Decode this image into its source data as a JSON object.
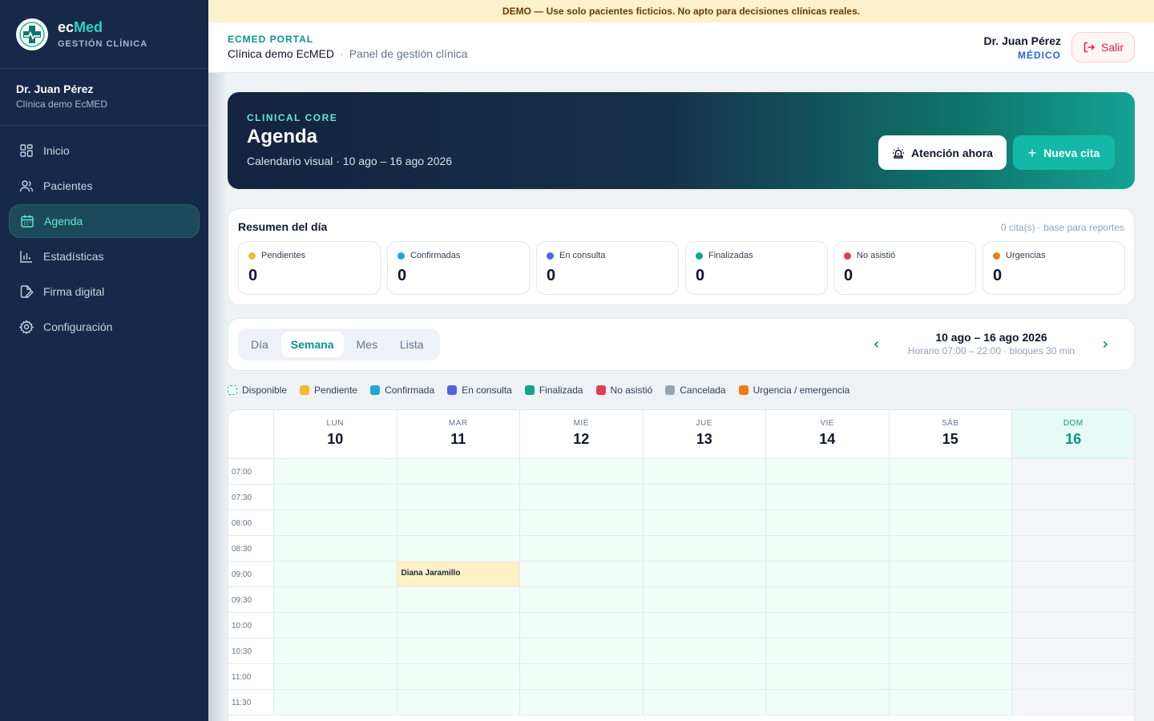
{
  "banner": {
    "text": "DEMO — Use solo pacientes ficticios. No apto para decisiones clínicas reales."
  },
  "brand": {
    "name_prefix": "ec",
    "name_accent": "Med",
    "subtitle": "GESTIÓN CLÍNICA"
  },
  "sidebar": {
    "user_name": "Dr. Juan Pérez",
    "user_clinic": "Clínica demo EcMED",
    "items": [
      {
        "label": "Inicio",
        "icon": "dashboard-icon"
      },
      {
        "label": "Pacientes",
        "icon": "users-icon"
      },
      {
        "label": "Agenda",
        "icon": "calendar-icon",
        "active": true
      },
      {
        "label": "Estadísticas",
        "icon": "bar-chart-icon"
      },
      {
        "label": "Firma digital",
        "icon": "signature-icon"
      },
      {
        "label": "Configuración",
        "icon": "gear-icon"
      }
    ]
  },
  "header": {
    "portal_label": "ECMED PORTAL",
    "clinic": "Clínica demo EcMED",
    "separator": "·",
    "panel": "Panel de gestión clínica",
    "user_name": "Dr. Juan Pérez",
    "user_role": "MÉDICO",
    "logout_label": "Salir"
  },
  "hero": {
    "kicker": "CLINICAL CORE",
    "title": "Agenda",
    "subtitle": "Calendario visual · 10 ago – 16 ago 2026",
    "attention_label": "Atención ahora",
    "new_label": "Nueva cita"
  },
  "summary": {
    "title": "Resumen del día",
    "note": "0 cita(s) · base para reportes",
    "stats": [
      {
        "label": "Pendientes",
        "value": "0",
        "color": "#f5b82e"
      },
      {
        "label": "Confirmadas",
        "value": "0",
        "color": "#1fa6d6"
      },
      {
        "label": "En consulta",
        "value": "0",
        "color": "#5063e6"
      },
      {
        "label": "Finalizadas",
        "value": "0",
        "color": "#14a38b"
      },
      {
        "label": "No asistió",
        "value": "0",
        "color": "#e23b54"
      },
      {
        "label": "Urgencias",
        "value": "0",
        "color": "#f07b16"
      }
    ]
  },
  "toolbar": {
    "tabs": [
      "Día",
      "Semana",
      "Mes",
      "Lista"
    ],
    "active_tab": "Semana",
    "range_title": "10 ago – 16 ago 2026",
    "range_sub": "Horario 07:00 – 22:00 · bloques 30 min"
  },
  "legend": [
    {
      "label": "Disponible",
      "color": "#14b8a6",
      "style": "dashed"
    },
    {
      "label": "Pendiente",
      "color": "#f5b82e"
    },
    {
      "label": "Confirmada",
      "color": "#1fa6d6"
    },
    {
      "label": "En consulta",
      "color": "#5063e6"
    },
    {
      "label": "Finalizada",
      "color": "#14a38b"
    },
    {
      "label": "No asistió",
      "color": "#e23b54"
    },
    {
      "label": "Cancelada",
      "color": "#9aa3b2"
    },
    {
      "label": "Urgencia / emergencia",
      "color": "#f07b16"
    }
  ],
  "calendar": {
    "days": [
      {
        "name": "LUN",
        "date": "10",
        "available": true
      },
      {
        "name": "MAR",
        "date": "11",
        "available": true
      },
      {
        "name": "MIÉ",
        "date": "12",
        "available": true
      },
      {
        "name": "JUE",
        "date": "13",
        "available": true
      },
      {
        "name": "VIE",
        "date": "14",
        "available": true
      },
      {
        "name": "SÁB",
        "date": "15",
        "available": true
      },
      {
        "name": "DOM",
        "date": "16",
        "available": false,
        "today": true
      }
    ],
    "times": [
      "07:00",
      "07:30",
      "08:00",
      "08:30",
      "09:00",
      "09:30",
      "10:00",
      "10:30",
      "11:00",
      "11:30"
    ],
    "appointments": [
      {
        "patient": "Diana Jaramillo",
        "day": "11",
        "time": "09:00",
        "status": "Pendiente",
        "color": "#fdf0c4"
      }
    ]
  }
}
